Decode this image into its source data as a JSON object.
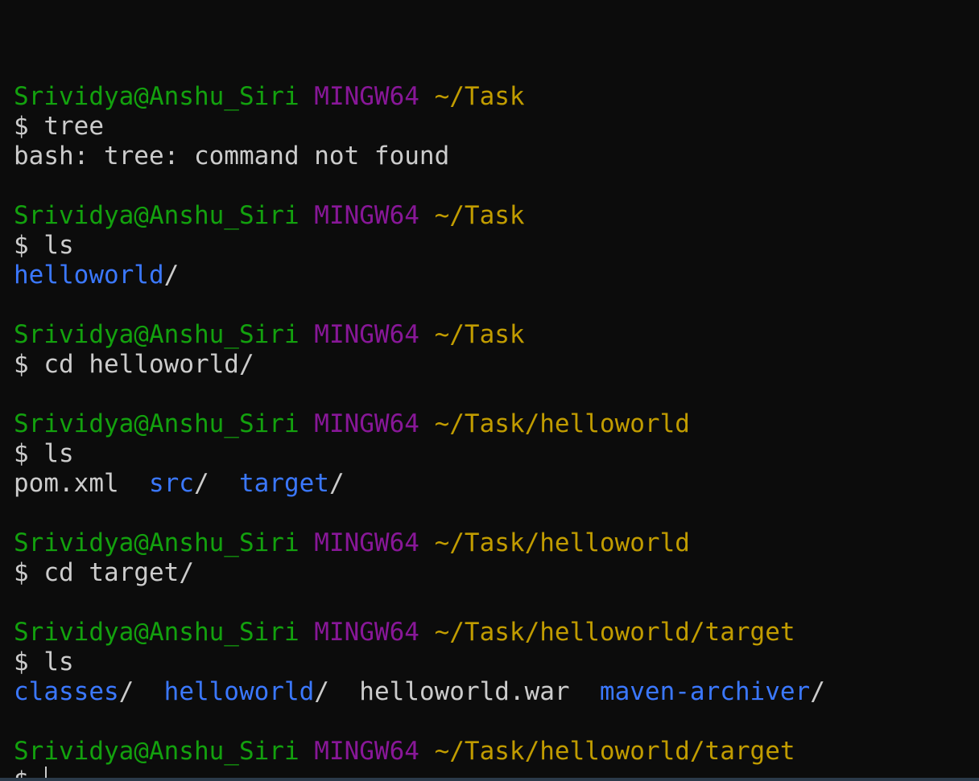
{
  "prompt": {
    "user": "Srividya@Anshu_Siri",
    "host": "MINGW64",
    "symbol": "$"
  },
  "blocks": [
    {
      "path": "~/Task",
      "command": "tree",
      "output": [
        [
          {
            "text": "bash: tree: command not found",
            "type": "plain"
          }
        ]
      ]
    },
    {
      "path": "~/Task",
      "command": "ls",
      "output": [
        [
          {
            "text": "helloworld",
            "type": "dir"
          },
          {
            "text": "/",
            "type": "plain"
          }
        ]
      ]
    },
    {
      "path": "~/Task",
      "command": "cd helloworld/",
      "output": []
    },
    {
      "path": "~/Task/helloworld",
      "command": "ls",
      "output": [
        [
          {
            "text": "pom.xml",
            "type": "plain"
          },
          {
            "text": "  ",
            "type": "plain"
          },
          {
            "text": "src",
            "type": "dir"
          },
          {
            "text": "/  ",
            "type": "plain"
          },
          {
            "text": "target",
            "type": "dir"
          },
          {
            "text": "/",
            "type": "plain"
          }
        ]
      ]
    },
    {
      "path": "~/Task/helloworld",
      "command": "cd target/",
      "output": []
    },
    {
      "path": "~/Task/helloworld/target",
      "command": "ls",
      "output": [
        [
          {
            "text": "classes",
            "type": "dir"
          },
          {
            "text": "/  ",
            "type": "plain"
          },
          {
            "text": "helloworld",
            "type": "dir"
          },
          {
            "text": "/  ",
            "type": "plain"
          },
          {
            "text": "helloworld.war",
            "type": "plain"
          },
          {
            "text": "  ",
            "type": "plain"
          },
          {
            "text": "maven-archiver",
            "type": "dir"
          },
          {
            "text": "/",
            "type": "plain"
          }
        ]
      ]
    }
  ],
  "active": {
    "path": "~/Task/helloworld/target",
    "command": ""
  },
  "colors": {
    "background": "#0c0c0c",
    "user": "#13a10e",
    "host": "#881798",
    "path": "#c19c00",
    "text": "#cccccc",
    "directory": "#3b78ff"
  }
}
